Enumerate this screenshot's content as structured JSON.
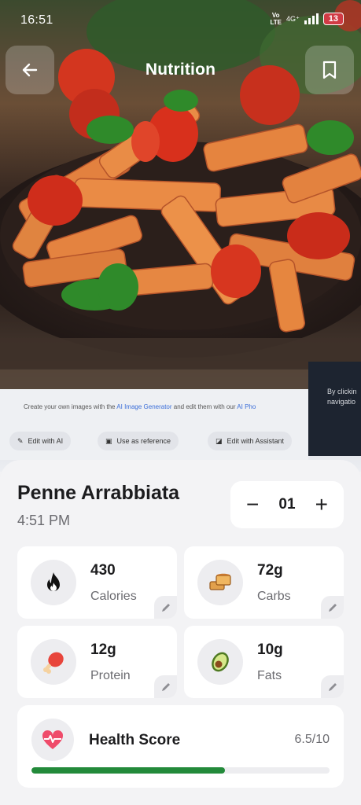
{
  "status_bar": {
    "time": "16:51",
    "network": "4G⁺",
    "volte_top": "Vo",
    "volte_bottom": "LTE",
    "battery": "13"
  },
  "header": {
    "title": "Nutrition",
    "back_icon": "arrow-left-icon",
    "bookmark_icon": "bookmark-icon"
  },
  "photo_overlay": {
    "caption_pre": "Create your own images with the",
    "caption_link1": "AI Image Generator",
    "caption_mid": "and edit them with our",
    "caption_link2": "AI Pho",
    "pill_edit_ai": "Edit with AI",
    "pill_reference": "Use as reference",
    "pill_assistant": "Edit with Assistant",
    "side_text_1": "By clickin",
    "side_text_2": "navigatio"
  },
  "dish": {
    "name": "Penne Arrabbiata",
    "time": "4:51 PM",
    "quantity": "01",
    "minus": "−",
    "plus": "+"
  },
  "macros": [
    {
      "value": "430",
      "label": "Calories",
      "icon": "flame-icon"
    },
    {
      "value": "72g",
      "label": "Carbs",
      "icon": "bread-icon"
    },
    {
      "value": "12g",
      "label": "Protein",
      "icon": "drumstick-icon"
    },
    {
      "value": "10g",
      "label": "Fats",
      "icon": "avocado-icon"
    }
  ],
  "health": {
    "title": "Health Score",
    "score": "6.5/10",
    "progress": 0.65,
    "icon": "heart-pulse-icon",
    "bar_color": "#238a3a"
  },
  "colors": {
    "accent_green": "#238a3a",
    "battery_red": "#d13b45"
  }
}
